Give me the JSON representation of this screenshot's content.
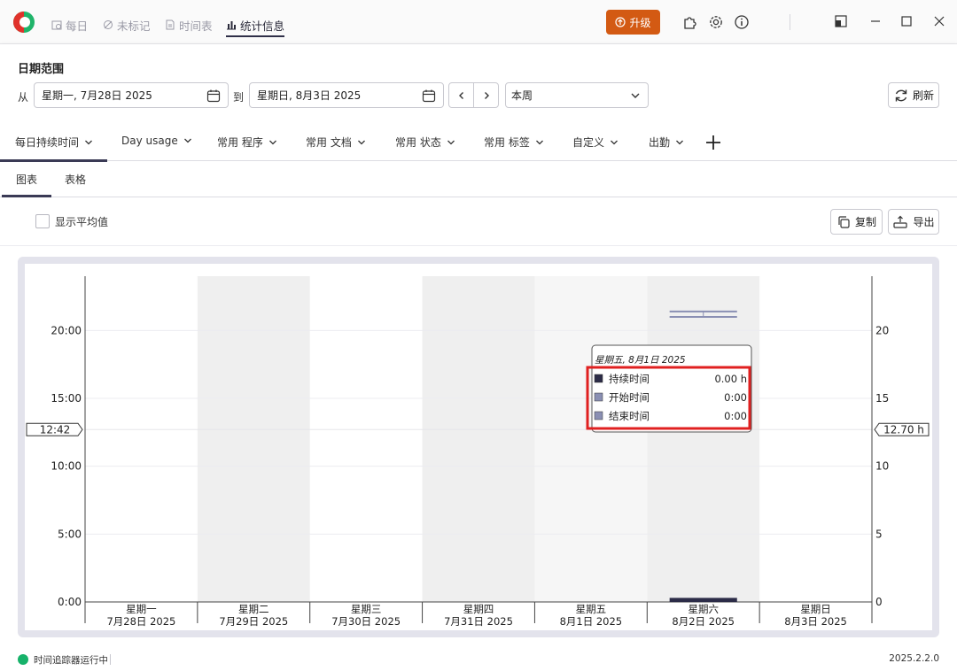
{
  "titlebar": {
    "tabs": [
      {
        "label": "每日",
        "icon": "calendar-clock-icon"
      },
      {
        "label": "未标记",
        "icon": "untagged-icon"
      },
      {
        "label": "时间表",
        "icon": "document-icon"
      },
      {
        "label": "统计信息",
        "icon": "bar-chart-icon",
        "active": true
      }
    ],
    "upgrade_label": "升级",
    "colors": {
      "upgrade": "#d35a13",
      "accent": "#2f2f48"
    }
  },
  "date_range": {
    "title": "日期范围",
    "from_label": "从",
    "from_value": "星期一, 7月28日 2025",
    "to_label": "到",
    "to_value": "星期日, 8月3日 2025",
    "period": "本周",
    "refresh_label": "刷新"
  },
  "category_tabs": [
    {
      "label": "每日持续时间",
      "active": true
    },
    {
      "label": "Day usage"
    },
    {
      "label": "常用 程序"
    },
    {
      "label": "常用 文档"
    },
    {
      "label": "常用 状态"
    },
    {
      "label": "常用 标签"
    },
    {
      "label": "自定义"
    },
    {
      "label": "出勤"
    }
  ],
  "sub_tabs": [
    {
      "label": "图表",
      "active": true
    },
    {
      "label": "表格"
    }
  ],
  "toolbar": {
    "show_average_label": "显示平均值",
    "show_average_checked": false,
    "copy_label": "复制",
    "export_label": "导出"
  },
  "chart_data": {
    "type": "bar",
    "categories": [
      [
        "星期一",
        "7月28日 2025"
      ],
      [
        "星期二",
        "7月29日 2025"
      ],
      [
        "星期三",
        "7月30日 2025"
      ],
      [
        "星期四",
        "7月31日 2025"
      ],
      [
        "星期五",
        "8月1日 2025"
      ],
      [
        "星期六",
        "8月2日 2025"
      ],
      [
        "星期日",
        "8月3日 2025"
      ]
    ],
    "series": [
      {
        "name": "持续时间",
        "values": [
          0,
          0,
          0,
          0,
          0,
          0.3,
          0
        ],
        "color": "#2c2c48"
      }
    ],
    "range_markers": [
      {
        "category": 5,
        "start": 21.4,
        "end": 21.0
      }
    ],
    "left_axis": {
      "ticks": [
        "0:00",
        "5:00",
        "10:00",
        "15:00",
        "20:00"
      ],
      "tick_values": [
        0,
        5,
        10,
        15,
        20
      ],
      "marker": "12:42"
    },
    "right_axis": {
      "ticks": [
        "0",
        "5",
        "10",
        "15",
        "20"
      ],
      "tick_values": [
        0,
        5,
        10,
        15,
        20
      ],
      "marker": "12.70 h"
    },
    "ylim": [
      0,
      24
    ],
    "marker_value": 12.7,
    "shaded_columns": [
      1,
      3,
      5
    ],
    "hover_column": 4,
    "colors": {
      "bar": "#2c2c48",
      "range": "#8a8fb3",
      "shade": "#efefef",
      "hover": "#f6f6f6"
    },
    "tooltip": {
      "title": "星期五, 8月1日 2025",
      "rows": [
        {
          "label": "持续时间",
          "value": "0.00 h",
          "color": "#2c2c48"
        },
        {
          "label": "开始时间",
          "value": "0:00",
          "color": "#8a8fb3"
        },
        {
          "label": "结束时间",
          "value": "0:00",
          "color": "#8a8fb3"
        }
      ],
      "highlight_color": "#e02020"
    }
  },
  "status": {
    "tracker_text": "时间追踪器运行中",
    "version": "2025.2.2.0"
  }
}
